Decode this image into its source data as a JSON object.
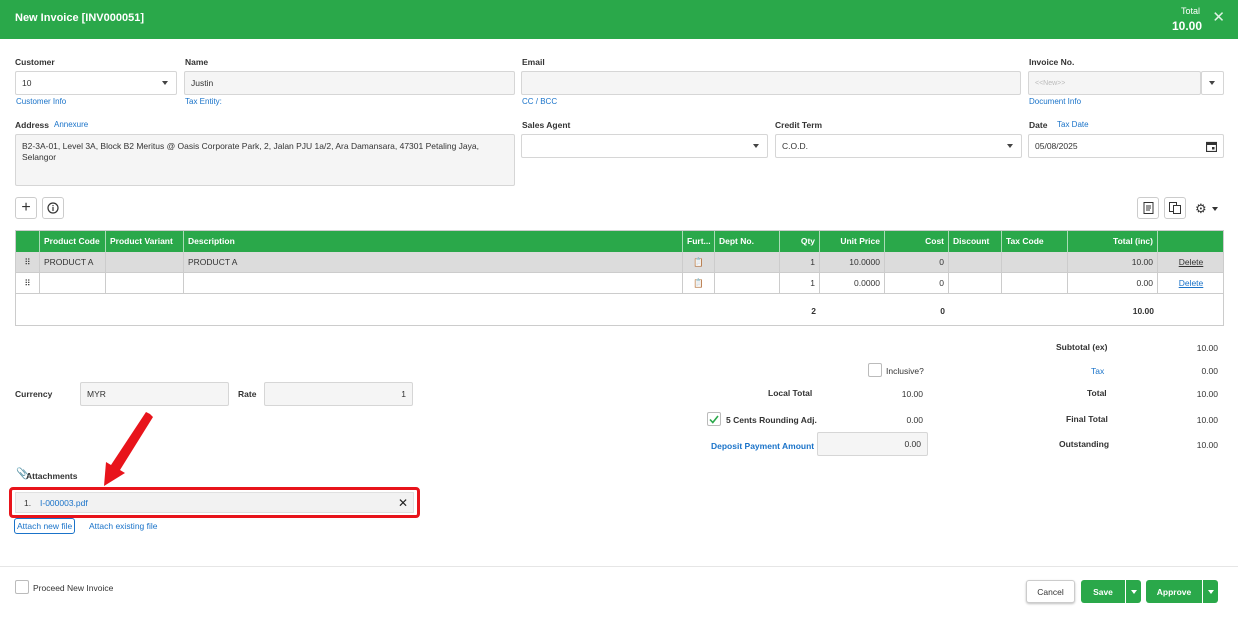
{
  "header": {
    "title": "New Invoice [INV000051]",
    "total_label": "Total",
    "total_value": "10.00"
  },
  "form": {
    "customer": {
      "label": "Customer",
      "value": "10",
      "link": "Customer Info"
    },
    "name": {
      "label": "Name",
      "value": "Justin",
      "link": "Tax Entity:"
    },
    "email": {
      "label": "Email",
      "value": "",
      "link": "CC / BCC"
    },
    "invoice_no": {
      "label": "Invoice No.",
      "placeholder": "<<New>>",
      "link": "Document Info"
    },
    "address": {
      "label": "Address",
      "link": "Annexure",
      "value": "B2-3A-01, Level 3A, Block B2 Meritus @ Oasis Corporate Park, 2, Jalan PJU 1a/2, Ara Damansara, 47301 Petaling Jaya, Selangor"
    },
    "sales_agent": {
      "label": "Sales Agent",
      "value": ""
    },
    "credit_term": {
      "label": "Credit Term",
      "value": "C.O.D."
    },
    "date": {
      "label": "Date",
      "link": "Tax Date",
      "value": "05/08/2025"
    }
  },
  "grid": {
    "headers": [
      "Product Code",
      "Product Variant",
      "Description",
      "Furt...",
      "Dept No.",
      "Qty",
      "Unit Price",
      "Cost",
      "Discount",
      "Tax Code",
      "Total (inc)"
    ],
    "rows": [
      {
        "code": "PRODUCT A",
        "variant": "",
        "desc": "PRODUCT A",
        "dept": "",
        "qty": "1",
        "price": "10.0000",
        "cost": "0",
        "discount": "",
        "tax": "",
        "total": "10.00",
        "action": "Delete"
      },
      {
        "code": "",
        "variant": "",
        "desc": "",
        "dept": "",
        "qty": "1",
        "price": "0.0000",
        "cost": "0",
        "discount": "",
        "tax": "",
        "total": "0.00",
        "action": "Delete"
      }
    ],
    "footer": {
      "qty": "2",
      "cost": "0",
      "total": "10.00"
    }
  },
  "currency": {
    "label": "Currency",
    "value": "MYR",
    "rate_label": "Rate",
    "rate_value": "1"
  },
  "middle": {
    "inclusive_label": "Inclusive?",
    "local_total_label": "Local Total",
    "local_total_value": "10.00",
    "rounding_label": "5 Cents Rounding Adj.",
    "rounding_value": "0.00",
    "deposit_label": "Deposit Payment Amount",
    "deposit_value": "0.00"
  },
  "summary": {
    "subtotal_label": "Subtotal (ex)",
    "subtotal_value": "10.00",
    "tax_label": "Tax",
    "tax_value": "0.00",
    "total_label": "Total",
    "total_value": "10.00",
    "final_label": "Final Total",
    "final_value": "10.00",
    "outstanding_label": "Outstanding",
    "outstanding_value": "10.00"
  },
  "attachments": {
    "label": "Attachments",
    "items": [
      {
        "index": "1.",
        "name": "I-000003.pdf"
      }
    ],
    "attach_new": "Attach new file",
    "attach_existing": "Attach existing file"
  },
  "footer": {
    "proceed_label": "Proceed New Invoice",
    "cancel": "Cancel",
    "save": "Save",
    "approve": "Approve"
  },
  "colors": {
    "brand_green": "#2aa84a",
    "link_blue": "#1a73c9",
    "annotation_red": "#e8141b"
  }
}
